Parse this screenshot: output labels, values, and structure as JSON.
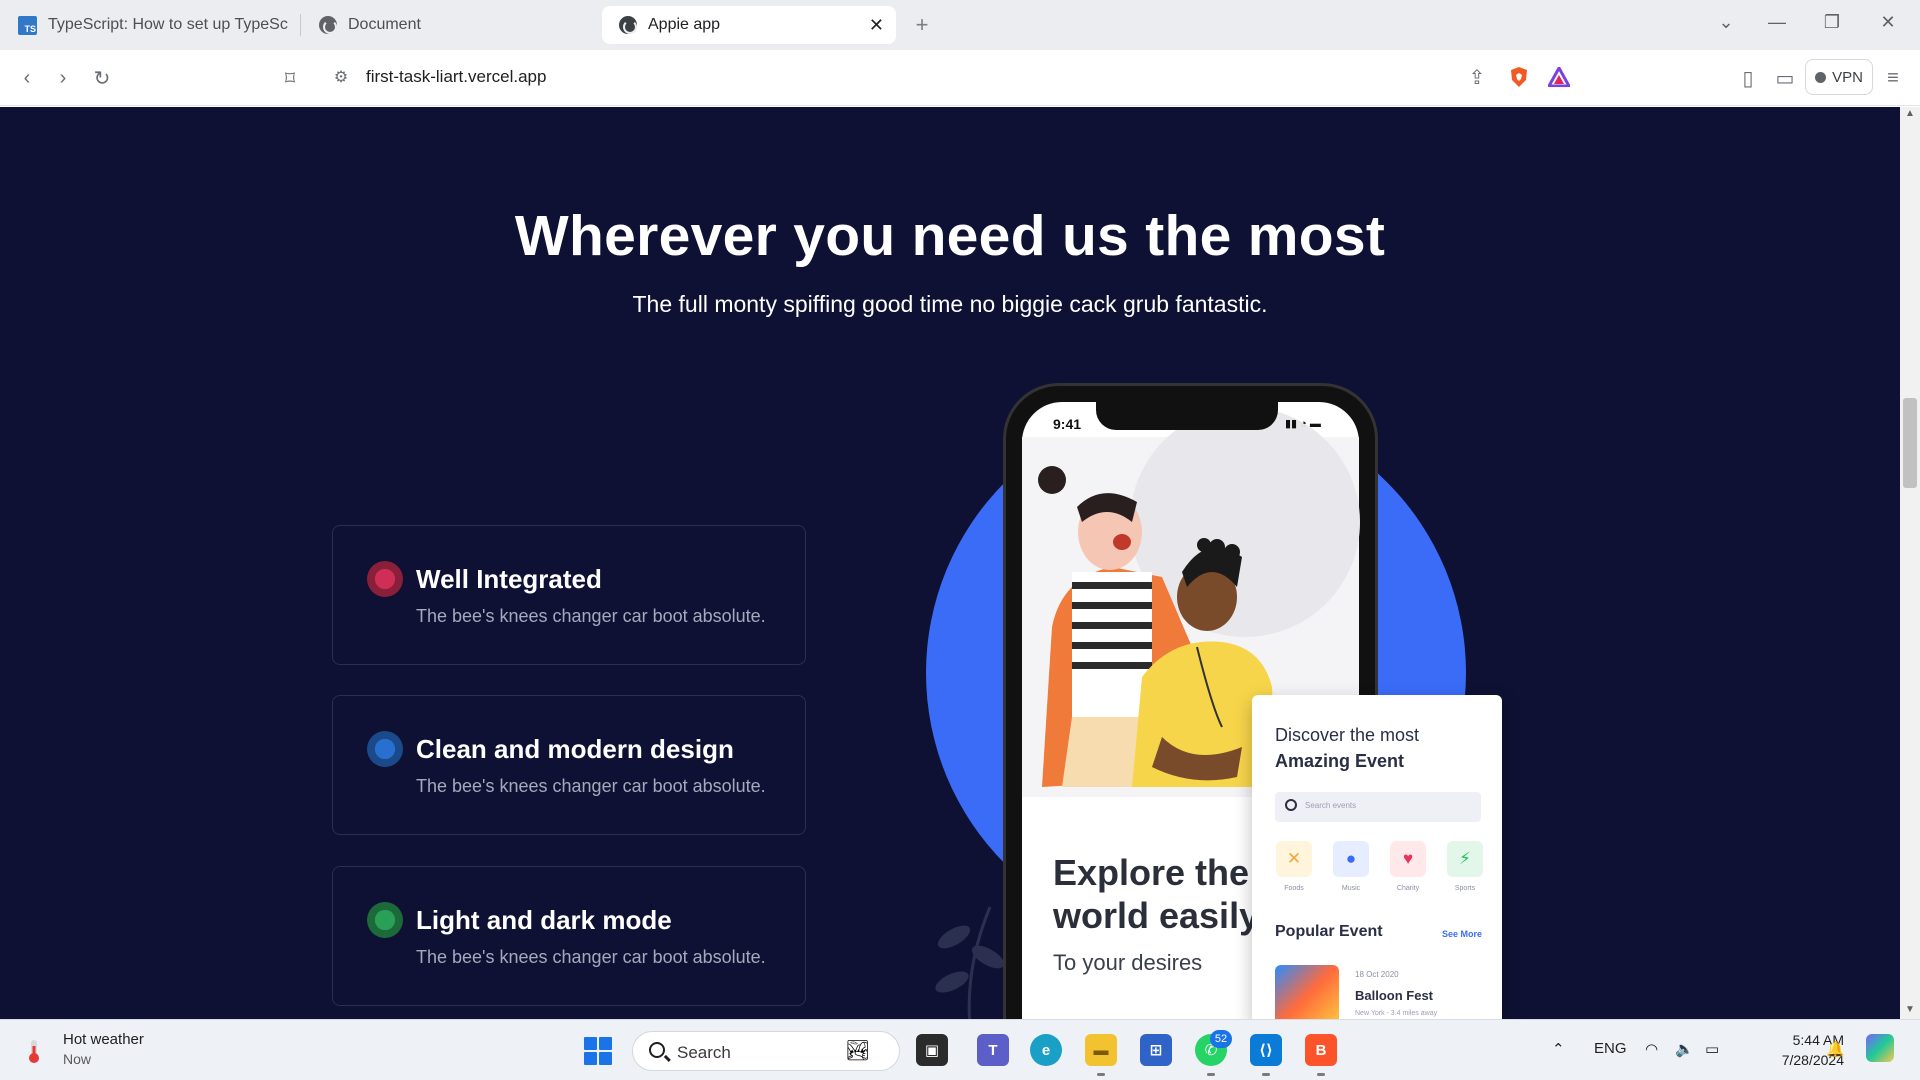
{
  "browser": {
    "tabs": [
      {
        "title": "TypeScript: How to set up TypeScrip",
        "icon": "typescript-icon",
        "favicon_text": "TS"
      },
      {
        "title": "Document",
        "icon": "globe-icon"
      },
      {
        "title": "Appie app",
        "icon": "globe-icon",
        "active": true
      }
    ],
    "new_tab": "+",
    "url": "first-task-liart.vercel.app",
    "vpn_label": "VPN"
  },
  "page": {
    "headline": "Wherever you need us the most",
    "subheadline": "The full monty spiffing good time no biggie cack grub fantastic.",
    "features": [
      {
        "title": "Well Integrated",
        "description": "The bee's knees changer car boot absolute.",
        "color": "#e8345a"
      },
      {
        "title": "Clean and modern design",
        "description": "The bee's knees changer car boot absolute.",
        "color": "#1ea2f0"
      },
      {
        "title": "Light and dark mode",
        "description": "The bee's knees changer car boot absolute.",
        "color": "#22c55e"
      }
    ],
    "phone": {
      "time": "9:41",
      "headline_line1": "Explore the",
      "headline_line2": "world easily",
      "tagline": "To your desires",
      "card": {
        "title_line1": "Discover the most",
        "title_line2": "Amazing Event",
        "search_placeholder": "Search events",
        "categories": [
          "Foods",
          "Music",
          "Charity",
          "Sports"
        ],
        "popular_title": "Popular Event",
        "see_more": "See More",
        "event": {
          "date": "18 Oct 2020",
          "name": "Balloon Fest",
          "location": "New York - 3.4 miles away"
        }
      }
    }
  },
  "taskbar": {
    "weather_title": "Hot weather",
    "weather_subtitle": "Now",
    "search_label": "Search",
    "whatsapp_badge": "52",
    "language": "ENG",
    "time": "5:44 AM",
    "date": "7/28/2024"
  },
  "colors": {
    "page_background": "#0e1133",
    "accent_blue": "#3b6cf7"
  }
}
